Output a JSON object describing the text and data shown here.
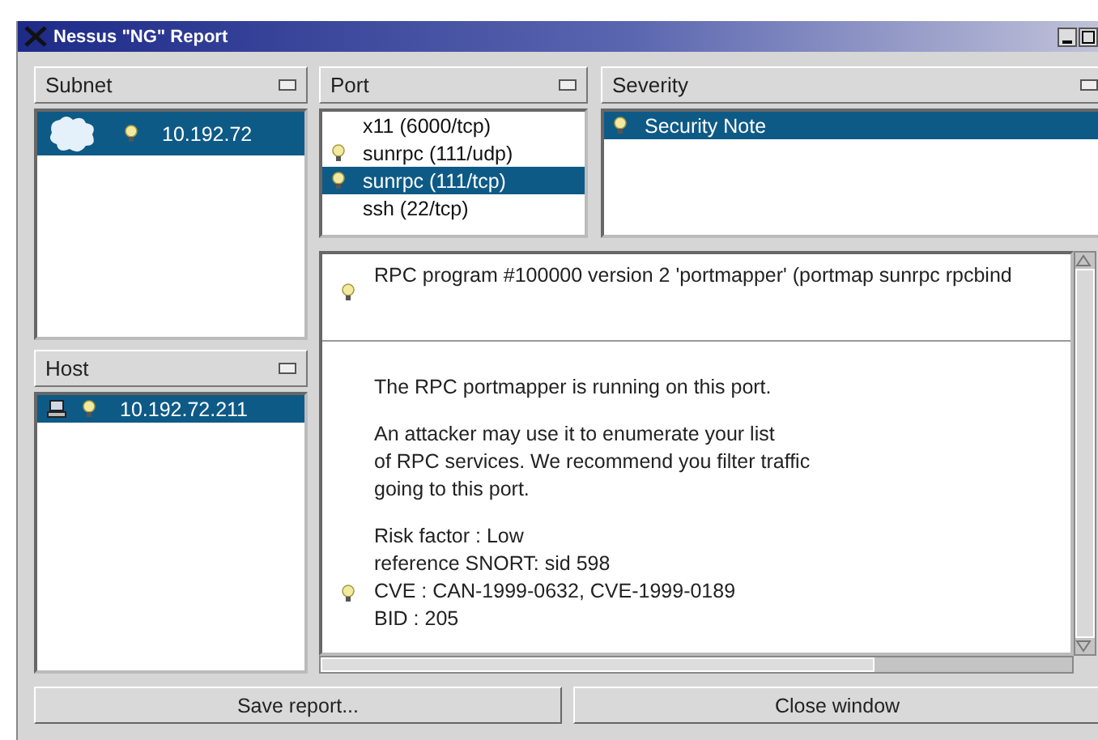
{
  "window": {
    "title": "Nessus \"NG\" Report"
  },
  "subnet": {
    "header": "Subnet",
    "items": [
      {
        "label": "10.192.72",
        "selected": true,
        "flagged": true
      }
    ]
  },
  "host": {
    "header": "Host",
    "items": [
      {
        "label": "10.192.72.211",
        "selected": true,
        "flagged": true
      }
    ]
  },
  "port": {
    "header": "Port",
    "items": [
      {
        "label": "x11 (6000/tcp)",
        "selected": false,
        "flagged": false
      },
      {
        "label": "sunrpc (111/udp)",
        "selected": false,
        "flagged": true
      },
      {
        "label": "sunrpc (111/tcp)",
        "selected": true,
        "flagged": true
      },
      {
        "label": "ssh (22/tcp)",
        "selected": false,
        "flagged": false
      }
    ]
  },
  "severity": {
    "header": "Severity",
    "items": [
      {
        "label": "Security Note",
        "selected": true,
        "flagged": true
      }
    ]
  },
  "report": {
    "entries": [
      {
        "paragraphs": [
          [
            "RPC program #100000 version 2 'portmapper' (portmap sunrpc rpcbind"
          ]
        ]
      },
      {
        "paragraphs": [
          [
            "The RPC portmapper is running on this port."
          ],
          [
            "An attacker may use it to enumerate your list",
            "of RPC services. We recommend you filter traffic",
            "going to this port."
          ],
          [
            "Risk factor : Low",
            "reference SNORT: sid 598",
            "CVE : CAN-1999-0632, CVE-1999-0189",
            "BID : 205"
          ]
        ]
      }
    ]
  },
  "buttons": [
    {
      "label": "Save report..."
    },
    {
      "label": "Close window"
    }
  ]
}
